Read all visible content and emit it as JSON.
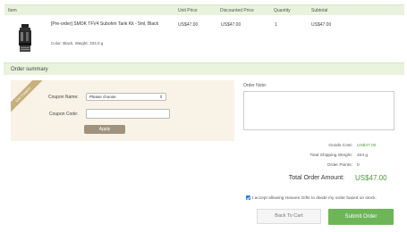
{
  "table": {
    "headers": {
      "item": "Item",
      "unit_price": "Unit Price",
      "discounted_price": "Discounted Price",
      "quantity": "Quantity",
      "subtotal": "Subtotal"
    },
    "rows": [
      {
        "name": "[Pre-order] SMOK TFV4 Subohm Tank Kit - 5ml, Black",
        "meta": "Color: Black, Weight: 334.0 g",
        "unit_price": "US$47.00",
        "discounted_price": "US$47.00",
        "quantity": "1",
        "subtotal": "US$47.00"
      }
    ]
  },
  "summary": {
    "title": "Order summary"
  },
  "coupon": {
    "ribbon": "Use Coupon",
    "name_label": "Coupon Name:",
    "name_value": "Please choose",
    "code_label": "Coupon Code:",
    "code_value": "",
    "apply_label": "Apply"
  },
  "note": {
    "label": "Order Note:",
    "value": ""
  },
  "totals": {
    "goods_cost_label": "Goods Cost:",
    "goods_cost_value": "US$47.00",
    "shipping_weight_label": "Total Shipping Weight:",
    "shipping_weight_value": "344 g",
    "order_points_label": "Order Points:",
    "order_points_value": "0",
    "total_label": "Total Order Amount:",
    "total_value": "US$47.00"
  },
  "divide": {
    "checked": true,
    "text": "I accept allowing Heaven Gifts to divide my order based on stock."
  },
  "buttons": {
    "back": "Back To Cart",
    "submit": "Submit Order"
  },
  "colors": {
    "header_bg": "#e8f2dd",
    "coupon_bg": "#f8f3e6",
    "accent_green": "#6db657",
    "price_green": "#4b9b3a"
  }
}
